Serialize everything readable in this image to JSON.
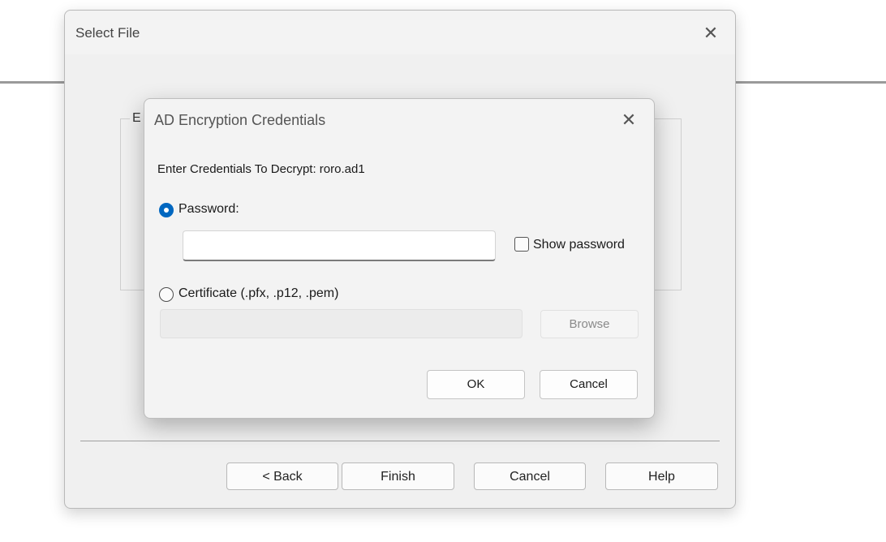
{
  "wizard": {
    "title": "Select File",
    "close_glyph": "✕",
    "group_label": "E",
    "buttons": {
      "back": "< Back",
      "finish": "Finish",
      "cancel": "Cancel",
      "help": "Help"
    }
  },
  "modal": {
    "title": "AD Encryption Credentials",
    "close_glyph": "✕",
    "prompt": "Enter Credentials To Decrypt: roro.ad1",
    "password_option": {
      "label": "Password:",
      "selected": true,
      "value": ""
    },
    "show_password": {
      "label": "Show password",
      "checked": false
    },
    "certificate_option": {
      "label": "Certificate (.pfx, .p12, .pem)",
      "selected": false,
      "path_value": ""
    },
    "browse_label": "Browse",
    "ok_label": "OK",
    "cancel_label": "Cancel"
  },
  "colors": {
    "accent": "#0067c0",
    "dialog_bg": "#f3f3f3"
  }
}
